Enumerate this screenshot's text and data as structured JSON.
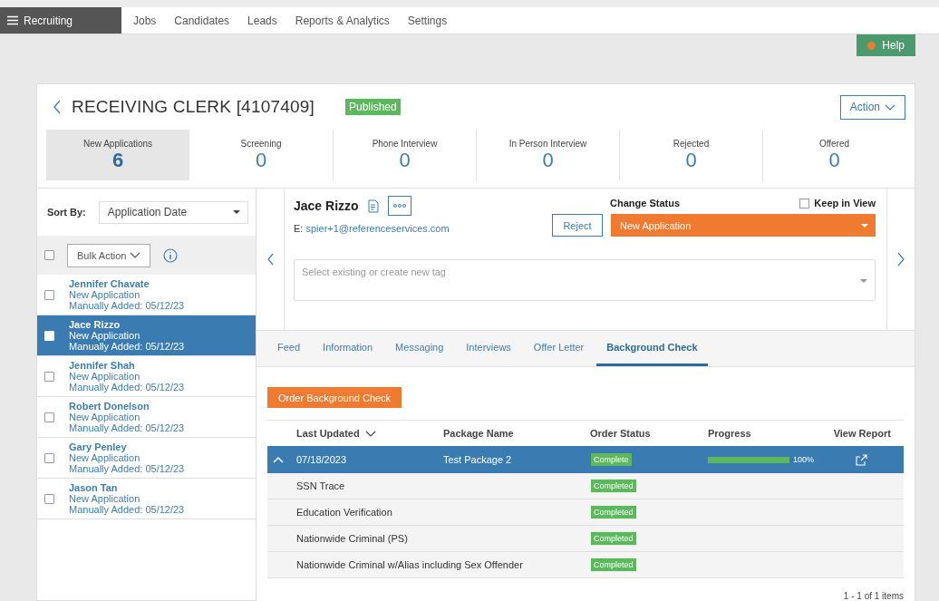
{
  "nav": {
    "app": "Recruiting",
    "items": [
      {
        "label": "Jobs",
        "selected": false
      },
      {
        "label": "Candidates",
        "selected": false
      },
      {
        "label": "Leads",
        "selected": false
      },
      {
        "label": "Reports & Analytics",
        "selected": false
      },
      {
        "label": "Settings",
        "selected": false
      }
    ]
  },
  "help": "Help",
  "job": {
    "title": "RECEIVING CLERK [4107409]",
    "status": "Published",
    "action": "Action",
    "stages": [
      {
        "label": "New Applications",
        "count": "6",
        "selected": true
      },
      {
        "label": "Screening",
        "count": "0",
        "selected": false
      },
      {
        "label": "Phone Interview",
        "count": "0",
        "selected": false
      },
      {
        "label": "In Person Interview",
        "count": "0",
        "selected": false
      },
      {
        "label": "Rejected",
        "count": "0",
        "selected": false
      },
      {
        "label": "Offered",
        "count": "0",
        "selected": false
      }
    ]
  },
  "list": {
    "sort_label": "Sort By:",
    "sort_value": "Application Date",
    "bulk_action": "Bulk Action",
    "select_all_checked": false,
    "candidates": [
      {
        "name": "Jennifer Chavate",
        "status": "New Application",
        "added": "Manually Added: 05/12/23",
        "selected": false
      },
      {
        "name": "Jace Rizzo",
        "status": "New Application",
        "added": "Manually Added: 05/12/23",
        "selected": true
      },
      {
        "name": "Jennifer Shah",
        "status": "New Application",
        "added": "Manually Added: 05/12/23",
        "selected": false
      },
      {
        "name": "Robert Donelson",
        "status": "New Application",
        "added": "Manually Added: 05/12/23",
        "selected": false
      },
      {
        "name": "Gary Penley",
        "status": "New Application",
        "added": "Manually Added: 05/12/23",
        "selected": false
      },
      {
        "name": "Jason Tan",
        "status": "New Application",
        "added": "Manually Added: 05/12/23",
        "selected": false
      }
    ]
  },
  "candidate": {
    "name": "Jace Rizzo",
    "email_label": "E:",
    "email": "spier+1@referenceservices.com",
    "reject": "Reject",
    "change_status_label": "Change Status",
    "status": "New Application",
    "keep_in_view": {
      "label": "Keep in View",
      "checked": false
    },
    "tag_placeholder": "Select existing or create new tag"
  },
  "tabs": [
    {
      "label": "Feed",
      "selected": false
    },
    {
      "label": "Information",
      "selected": false
    },
    {
      "label": "Messaging",
      "selected": false
    },
    {
      "label": "Interviews",
      "selected": false
    },
    {
      "label": "Offer Letter",
      "selected": false
    },
    {
      "label": "Background Check",
      "selected": true
    }
  ],
  "background_check": {
    "order_button": "Order Background Check",
    "columns": [
      "Last Updated",
      "Package Name",
      "Order Status",
      "Progress",
      "View Report"
    ],
    "package": {
      "expanded": true,
      "last_updated": "07/18/2023",
      "name": "Test Package 2",
      "status": "Complete",
      "level": 1,
      "progress": "100%"
    },
    "items": [
      {
        "name": "SSN Trace",
        "status": "Completed"
      },
      {
        "name": "Education Verification",
        "status": "Completed"
      },
      {
        "name": "Nationwide Criminal (PS)",
        "status": "Completed"
      },
      {
        "name": "Nationwide Criminal w/Alias including Sex Offender",
        "status": "Completed"
      }
    ],
    "pagination": "1 - 1 of 1 items"
  }
}
